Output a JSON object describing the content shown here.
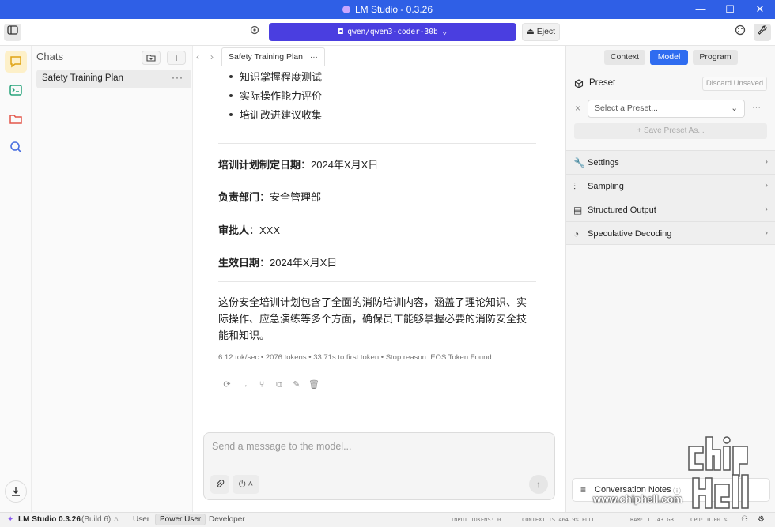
{
  "titlebar": {
    "title": "LM Studio - 0.3.26",
    "minimize": "—",
    "maximize": "☐",
    "close": "✕"
  },
  "toolbar": {
    "model": "qwen/qwen3-coder-30b",
    "eject": "Eject"
  },
  "chats": {
    "heading": "Chats",
    "items": [
      {
        "label": "Safety Training Plan",
        "menu": "···"
      }
    ]
  },
  "tab": {
    "label": "Safety Training Plan",
    "menu": "···"
  },
  "message": {
    "bullets": [
      "知识掌握程度测试",
      "实际操作能力评价",
      "培训改进建议收集"
    ],
    "fields": [
      {
        "key": "培训计划制定日期",
        "value": "：2024年X月X日"
      },
      {
        "key": "负责部门",
        "value": "：安全管理部"
      },
      {
        "key": "审批人",
        "value": "：XXX"
      },
      {
        "key": "生效日期",
        "value": "：2024年X月X日"
      }
    ],
    "summary": "这份安全培训计划包含了全面的消防培训内容，涵盖了理论知识、实际操作、应急演练等多个方面，确保员工能够掌握必要的消防安全技能和知识。",
    "stats": "6.12 tok/sec • 2076 tokens • 33.71s to first token • Stop reason: EOS Token Found"
  },
  "composer": {
    "placeholder": "Send a message to the model..."
  },
  "right_panel": {
    "tabs": [
      "Context",
      "Model",
      "Program"
    ],
    "active_tab": "Model",
    "preset": {
      "label": "Preset",
      "discard": "Discard Unsaved",
      "select": "Select a Preset...",
      "save": "Save Preset As..."
    },
    "sections": [
      "Settings",
      "Sampling",
      "Structured Output",
      "Speculative Decoding"
    ],
    "notes": "Conversation Notes"
  },
  "statusbar": {
    "app": "LM Studio 0.3.26",
    "build": "(Build 6)",
    "modes": [
      "User",
      "Power User",
      "Developer"
    ],
    "active_mode": "Power User",
    "input_tokens": "INPUT TOKENS:  0",
    "context": "CONTEXT IS 464.9% FULL",
    "ram": "RAM: 11.43 GB",
    "cpu": "CPU: 0.00 %"
  },
  "watermark": {
    "text": "www.chiphell.com"
  },
  "colors": {
    "titlebar": "#2f5fe6",
    "accent": "#4a3ee0",
    "active_tab": "#2f6cf0"
  }
}
